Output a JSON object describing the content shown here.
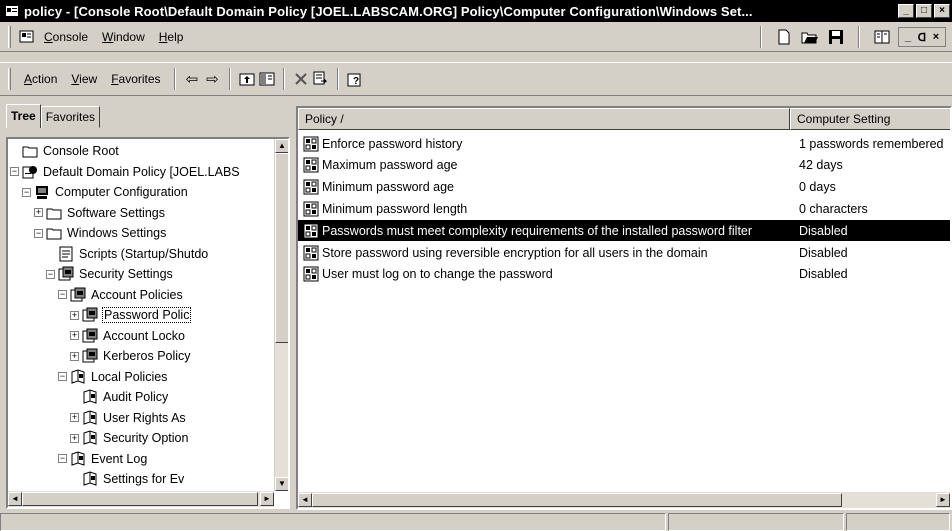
{
  "window": {
    "title": "policy - [Console Root\\Default Domain Policy [JOEL.LABSCAM.ORG] Policy\\Computer Configuration\\Windows Set...",
    "controls": [
      "minimize-icon",
      "maximize-icon",
      "close-icon"
    ]
  },
  "menubar": {
    "items": [
      {
        "label": "Console",
        "icon": "console-icon"
      },
      {
        "label": "Window"
      },
      {
        "label": "Help"
      }
    ],
    "right_icons": [
      "new-icon",
      "open-icon",
      "save-icon",
      "properties-icon"
    ],
    "mdi_controls": [
      "minimize-icon",
      "restore-icon",
      "close-icon"
    ]
  },
  "actionbar": {
    "items": [
      {
        "label": "Action"
      },
      {
        "label": "View"
      },
      {
        "label": "Favorites"
      }
    ],
    "nav": [
      "back-arrow-icon",
      "forward-arrow-icon"
    ],
    "toolbar_icons": [
      "up-one-level-icon",
      "show-hide-tree-icon",
      "delete-icon",
      "export-list-icon",
      "help-icon"
    ]
  },
  "tabs": [
    {
      "label": "Tree",
      "active": true
    },
    {
      "label": "Favorites",
      "active": false
    }
  ],
  "tree": {
    "nodes": [
      {
        "label": "Console Root",
        "expander": "",
        "icon": "folder-icon"
      },
      {
        "label": "Default Domain Policy [JOEL.LABS",
        "expander": "−",
        "icon": "policy-icon"
      },
      {
        "label": "Computer Configuration",
        "expander": "−",
        "icon": "computer-icon"
      },
      {
        "label": "Software Settings",
        "expander": "+",
        "icon": "folder-icon"
      },
      {
        "label": "Windows Settings",
        "expander": "−",
        "icon": "folder-icon"
      },
      {
        "label": "Scripts (Startup/Shutdo",
        "expander": "",
        "icon": "script-icon"
      },
      {
        "label": "Security Settings",
        "expander": "−",
        "icon": "security-icon"
      },
      {
        "label": "Account Policies",
        "expander": "−",
        "icon": "security-icon"
      },
      {
        "label": "Password Polic",
        "expander": "+",
        "icon": "security-icon",
        "selected": true
      },
      {
        "label": "Account Locko",
        "expander": "+",
        "icon": "security-icon"
      },
      {
        "label": "Kerberos Policy",
        "expander": "+",
        "icon": "security-icon"
      },
      {
        "label": "Local Policies",
        "expander": "−",
        "icon": "book-icon"
      },
      {
        "label": "Audit Policy",
        "expander": "",
        "icon": "book-icon"
      },
      {
        "label": "User Rights As",
        "expander": "+",
        "icon": "book-icon"
      },
      {
        "label": "Security Option",
        "expander": "+",
        "icon": "book-icon"
      },
      {
        "label": "Event Log",
        "expander": "−",
        "icon": "book-icon"
      },
      {
        "label": "Settings for Ev",
        "expander": "",
        "icon": "book-icon"
      }
    ]
  },
  "list": {
    "columns": [
      "Policy  /",
      "Computer Setting"
    ],
    "rows": [
      {
        "policy": "Enforce password history",
        "setting": "1 passwords remembered",
        "selected": false
      },
      {
        "policy": "Maximum password age",
        "setting": "42 days",
        "selected": false
      },
      {
        "policy": "Minimum password age",
        "setting": "0 days",
        "selected": false
      },
      {
        "policy": "Minimum password length",
        "setting": "0 characters",
        "selected": false
      },
      {
        "policy": "Passwords must meet complexity requirements of the installed password filter",
        "setting": "Disabled",
        "selected": true
      },
      {
        "policy": "Store password using reversible encryption for all users in the domain",
        "setting": "Disabled",
        "selected": false
      },
      {
        "policy": "User must log on to change the password",
        "setting": "Disabled",
        "selected": false
      }
    ]
  },
  "colors": {
    "titlebar_bg": "#000000",
    "chrome": "#d4d0c8",
    "selection_bg": "#000000",
    "selection_fg": "#ffffff"
  }
}
